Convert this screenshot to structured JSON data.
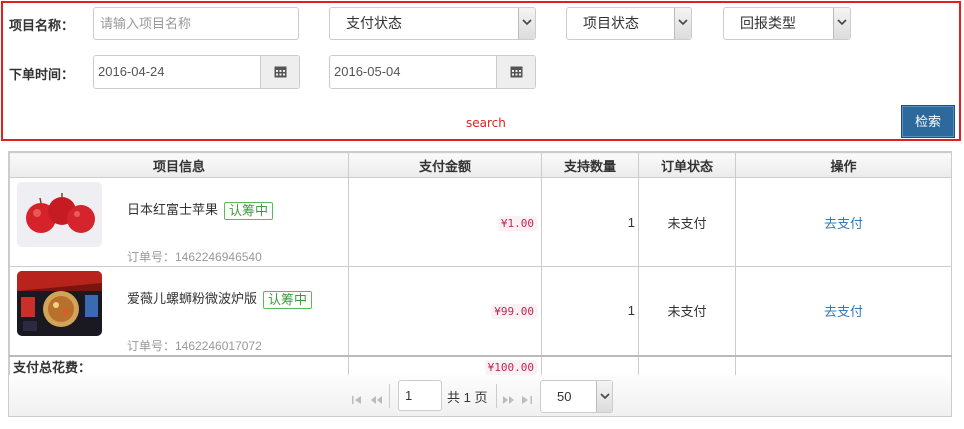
{
  "filters": {
    "project_name_label": "项目名称：",
    "project_name_placeholder": "请输入项目名称",
    "pay_status_select": "支付状态",
    "project_status_select": "项目状态",
    "reward_type_select": "回报类型",
    "order_time_label": "下单时间：",
    "date_from": "2016-04-24",
    "date_to": "2016-05-04",
    "search_link": "search",
    "search_button": "检索"
  },
  "table": {
    "headers": [
      "项目信息",
      "支付金额",
      "支持数量",
      "订单状态",
      "操作"
    ],
    "rows": [
      {
        "name": "日本红富士苹果",
        "badge": "认筹中",
        "order_no": "订单号：1462246946540",
        "amount": "¥1.00",
        "qty": "1",
        "status": "未支付",
        "action": "去支付",
        "thumb_icon": "apple-photo"
      },
      {
        "name": "爱薇儿螺蛳粉微波炉版",
        "badge": "认筹中",
        "order_no": "订单号：1462246017072",
        "amount": "¥99.00",
        "qty": "1",
        "status": "未支付",
        "action": "去支付",
        "thumb_icon": "noodle-photo"
      }
    ],
    "total_label": "支付总花费：",
    "total_amount": "¥100.00"
  },
  "pager": {
    "current_page": "1",
    "total_text": "共 1 页",
    "page_size": "50"
  },
  "colors": {
    "highlight_border": "#e0201f",
    "primary_button": "#2c6a9e",
    "badge_green": "#5cb85c",
    "amount_red": "#c7254e",
    "link_blue": "#337ab7"
  }
}
